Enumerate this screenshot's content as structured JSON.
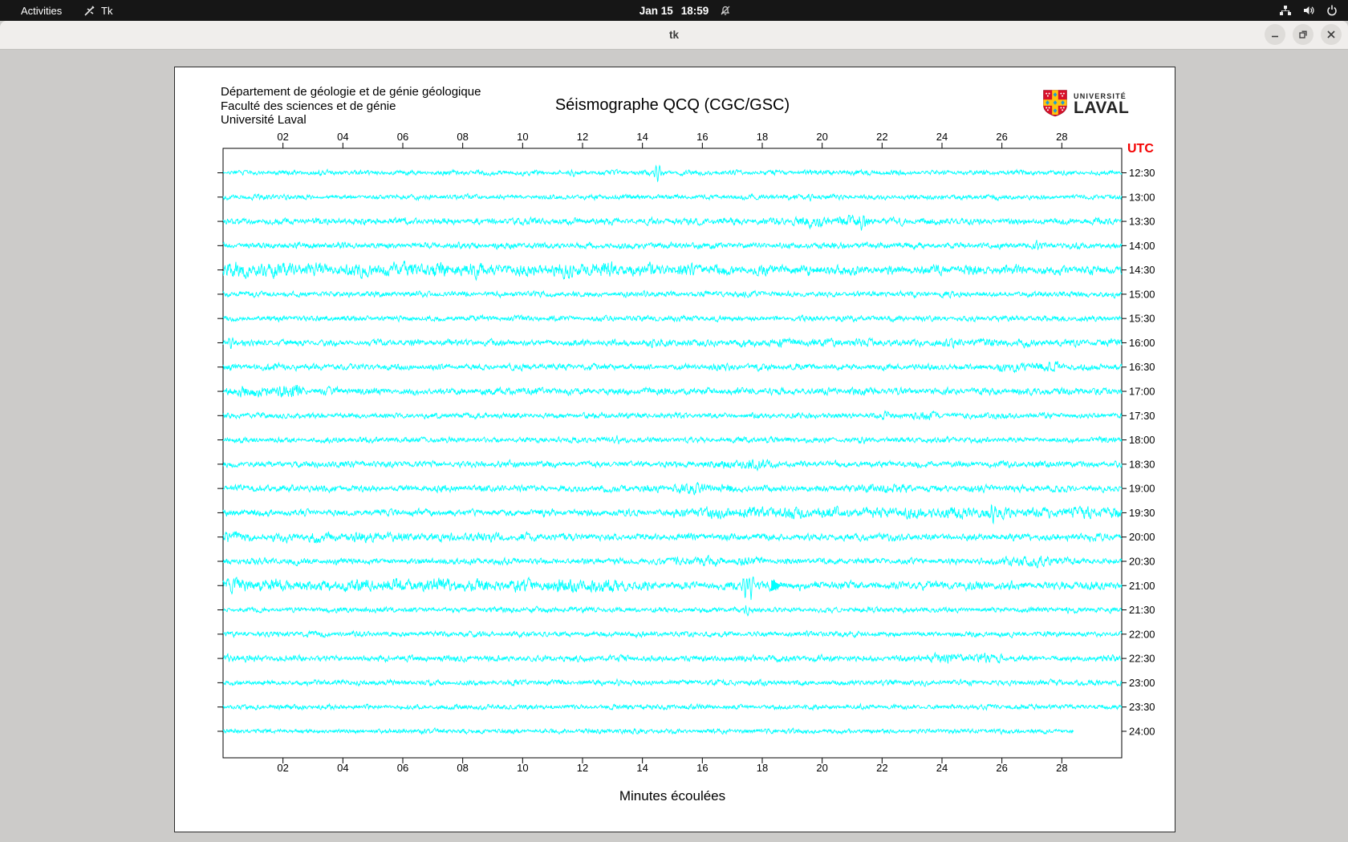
{
  "top_bar": {
    "activities_label": "Activities",
    "app_indicator": "Tk",
    "date": "Jan 15",
    "time": "18:59",
    "icons": [
      "tk-icon",
      "notifications-disabled-icon",
      "network-wired-icon",
      "volume-icon",
      "power-icon"
    ]
  },
  "title_bar": {
    "title": "tk",
    "controls": [
      "minimize",
      "maximize",
      "close"
    ]
  },
  "canvas": {
    "header_lines": [
      "Département de géologie et de génie géologique",
      "Faculté des sciences et de génie",
      "Université Laval"
    ],
    "plot_title": "Séismographe QCQ (CGC/GSC)",
    "logo": {
      "line1": "UNIVERSITÉ",
      "line2": "LAVAL"
    },
    "xlabel": "Minutes écoulées"
  },
  "chart_data": {
    "type": "seismogram-helicorder",
    "title": "Séismographe QCQ (CGC/GSC)",
    "xlabel": "Minutes écoulées",
    "utc_label": "UTC",
    "x_range_minutes": [
      0,
      30
    ],
    "x_tick_labels": [
      "02",
      "04",
      "06",
      "08",
      "10",
      "12",
      "14",
      "16",
      "18",
      "20",
      "22",
      "24",
      "26",
      "28"
    ],
    "trace_interval": "30 min per line",
    "colors": {
      "trace": "#00ffff",
      "axis": "#000000",
      "utc": "#f40000",
      "background": "#ffffff"
    },
    "traces": [
      {
        "label": "12:30",
        "amp": 2.2,
        "spikes": [
          {
            "m": 14.5,
            "a": 11
          },
          {
            "m": 11.7,
            "a": 4
          }
        ]
      },
      {
        "label": "13:00",
        "amp": 2.2,
        "spikes": [
          {
            "m": 19.6,
            "a": 4
          },
          {
            "m": 2.1,
            "a": 3.5
          }
        ]
      },
      {
        "label": "13:30",
        "amp": 3.0,
        "segs": [
          [
            19,
            21.6,
            1.7
          ]
        ],
        "spikes": [
          {
            "m": 21.3,
            "a": 7
          }
        ]
      },
      {
        "label": "14:00",
        "amp": 2.8,
        "spikes": [
          {
            "m": 27.2,
            "a": 5
          }
        ]
      },
      {
        "label": "14:30",
        "amp": 4.2,
        "segs": [
          [
            0,
            13,
            1.5
          ],
          [
            13,
            17,
            1.3
          ]
        ],
        "spikes": [
          {
            "m": 15.7,
            "a": 6
          },
          {
            "m": 8.3,
            "a": 5
          }
        ]
      },
      {
        "label": "15:00",
        "amp": 2.5,
        "spikes": [
          {
            "m": 14.1,
            "a": 4.5
          }
        ]
      },
      {
        "label": "15:30",
        "amp": 2.5,
        "spikes": []
      },
      {
        "label": "16:00",
        "amp": 2.8,
        "segs": [
          [
            14,
            30,
            1.25
          ]
        ],
        "spikes": [
          {
            "m": 0.25,
            "a": 8
          }
        ]
      },
      {
        "label": "16:30",
        "amp": 2.8,
        "segs": [
          [
            25.8,
            28,
            1.6
          ],
          [
            1.5,
            2.5,
            1.4
          ]
        ],
        "spikes": []
      },
      {
        "label": "17:00",
        "amp": 3.2,
        "segs": [
          [
            0,
            2.6,
            1.7
          ]
        ],
        "spikes": [
          {
            "m": 18.3,
            "a": 6
          }
        ]
      },
      {
        "label": "17:30",
        "amp": 2.5,
        "segs": [
          [
            22,
            24,
            1.6
          ]
        ],
        "spikes": []
      },
      {
        "label": "18:00",
        "amp": 2.5,
        "spikes": [
          {
            "m": 13.2,
            "a": 4
          },
          {
            "m": 21.4,
            "a": 5
          }
        ]
      },
      {
        "label": "18:30",
        "amp": 2.8,
        "segs": [
          [
            16.5,
            18.6,
            1.7
          ]
        ],
        "spikes": []
      },
      {
        "label": "19:00",
        "amp": 3.0,
        "segs": [
          [
            15,
            17,
            1.6
          ],
          [
            21.5,
            23,
            1.5
          ]
        ],
        "spikes": []
      },
      {
        "label": "19:30",
        "amp": 3.0,
        "segs": [
          [
            15,
            30,
            1.7
          ]
        ],
        "spikes": [
          {
            "m": 25.7,
            "a": 9
          }
        ]
      },
      {
        "label": "20:00",
        "amp": 3.2,
        "segs": [
          [
            0,
            10,
            1.3
          ]
        ],
        "spikes": [
          {
            "m": 0.15,
            "a": 7
          }
        ]
      },
      {
        "label": "20:30",
        "amp": 2.8,
        "segs": [
          [
            15,
            18,
            1.5
          ],
          [
            26,
            28.2,
            1.5
          ]
        ],
        "spikes": []
      },
      {
        "label": "21:00",
        "amp": 3.8,
        "segs": [
          [
            0,
            13.5,
            1.5
          ]
        ],
        "spikes": [
          {
            "m": 17.42,
            "a": 16
          },
          {
            "m": 17.62,
            "a": 16
          },
          {
            "m": 18.3,
            "a": 7,
            "shape": "wedge"
          }
        ]
      },
      {
        "label": "21:30",
        "amp": 2.4,
        "spikes": [
          {
            "m": 17.5,
            "a": 5
          }
        ]
      },
      {
        "label": "22:00",
        "amp": 2.4,
        "spikes": []
      },
      {
        "label": "22:30",
        "amp": 2.8,
        "segs": [
          [
            23.5,
            26,
            1.5
          ]
        ],
        "spikes": [
          {
            "m": 0.2,
            "a": 4
          }
        ]
      },
      {
        "label": "23:00",
        "amp": 2.4,
        "spikes": [
          {
            "m": 13.2,
            "a": 4
          }
        ]
      },
      {
        "label": "23:30",
        "amp": 2.2,
        "spikes": []
      },
      {
        "label": "24:00",
        "amp": 2.1,
        "end": 28.4,
        "spikes": []
      }
    ]
  }
}
